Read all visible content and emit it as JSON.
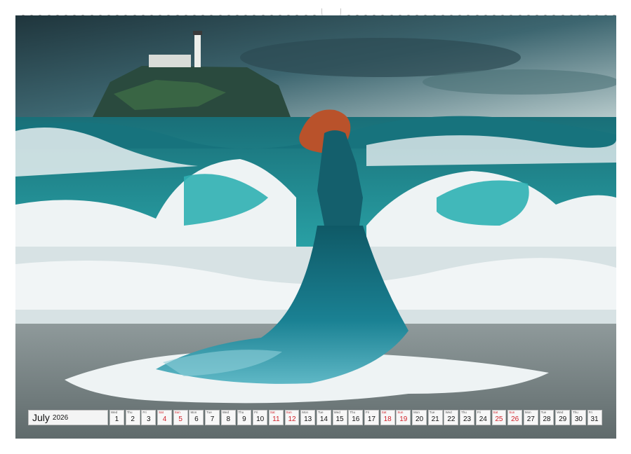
{
  "calendar": {
    "month": "July",
    "year": "2026",
    "days": [
      {
        "n": "1",
        "dow": "Wed",
        "weekend": false
      },
      {
        "n": "2",
        "dow": "Thu",
        "weekend": false
      },
      {
        "n": "3",
        "dow": "Fri",
        "weekend": false
      },
      {
        "n": "4",
        "dow": "Sat",
        "weekend": true
      },
      {
        "n": "5",
        "dow": "Sun",
        "weekend": true
      },
      {
        "n": "6",
        "dow": "Mon",
        "weekend": false
      },
      {
        "n": "7",
        "dow": "Tue",
        "weekend": false
      },
      {
        "n": "8",
        "dow": "Wed",
        "weekend": false
      },
      {
        "n": "9",
        "dow": "Thu",
        "weekend": false
      },
      {
        "n": "10",
        "dow": "Fri",
        "weekend": false
      },
      {
        "n": "11",
        "dow": "Sat",
        "weekend": true
      },
      {
        "n": "12",
        "dow": "Sun",
        "weekend": true
      },
      {
        "n": "13",
        "dow": "Mon",
        "weekend": false
      },
      {
        "n": "14",
        "dow": "Tue",
        "weekend": false
      },
      {
        "n": "15",
        "dow": "Wed",
        "weekend": false
      },
      {
        "n": "16",
        "dow": "Thu",
        "weekend": false
      },
      {
        "n": "17",
        "dow": "Fri",
        "weekend": false
      },
      {
        "n": "18",
        "dow": "Sat",
        "weekend": true
      },
      {
        "n": "19",
        "dow": "Sun",
        "weekend": true
      },
      {
        "n": "20",
        "dow": "Mon",
        "weekend": false
      },
      {
        "n": "21",
        "dow": "Tue",
        "weekend": false
      },
      {
        "n": "22",
        "dow": "Wed",
        "weekend": false
      },
      {
        "n": "23",
        "dow": "Thu",
        "weekend": false
      },
      {
        "n": "24",
        "dow": "Fri",
        "weekend": false
      },
      {
        "n": "25",
        "dow": "Sat",
        "weekend": true
      },
      {
        "n": "26",
        "dow": "Sun",
        "weekend": true
      },
      {
        "n": "27",
        "dow": "Mon",
        "weekend": false
      },
      {
        "n": "28",
        "dow": "Tue",
        "weekend": false
      },
      {
        "n": "29",
        "dow": "Wed",
        "weekend": false
      },
      {
        "n": "30",
        "dow": "Thu",
        "weekend": false
      },
      {
        "n": "31",
        "dow": "Fri",
        "weekend": false
      }
    ]
  },
  "colors": {
    "sky": "#2f4e57",
    "sea": "#1f8d96",
    "foam": "#eef3f4",
    "dress": "#1a6e7c",
    "hair": "#b9522b",
    "weekend": "#d0222a"
  }
}
